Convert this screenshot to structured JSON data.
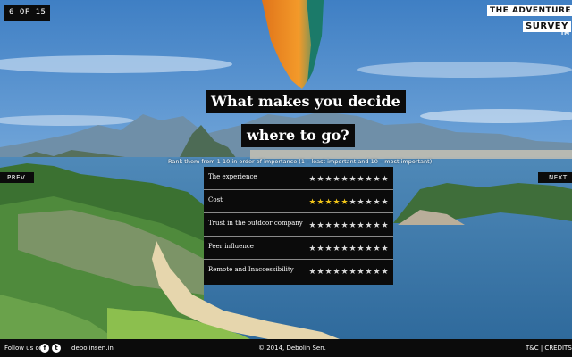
{
  "header": {
    "counter": "6 OF 15",
    "logo_line1": "THE ADVENTURE",
    "logo_line2": "SURVEY",
    "logo_tm": "TM"
  },
  "question": {
    "line1": "What makes you decide",
    "line2": "where to go?",
    "instructions": "Rank them from 1-10 in order of importance (1 – least important and 10 – most important)"
  },
  "nav": {
    "prev_label": "PREV",
    "next_label": "NEXT"
  },
  "ratings": [
    {
      "label": "The experience",
      "value": 0,
      "max": 10
    },
    {
      "label": "Cost",
      "value": 5,
      "max": 10
    },
    {
      "label": "Trust in the outdoor company",
      "value": 0,
      "max": 10
    },
    {
      "label": "Peer influence",
      "value": 0,
      "max": 10
    },
    {
      "label": "Remote and Inaccessibility",
      "value": 0,
      "max": 10
    }
  ],
  "footer": {
    "follow_label": "Follow us on:",
    "facebook_glyph": "f",
    "twitter_glyph": "t",
    "site": "debolinsen.in",
    "copyright": "© 2014, Debolin Sen.",
    "credits": "T&C | CREDITS"
  },
  "colors": {
    "sky": "#5a8fc7",
    "star_active": "#f0c419",
    "star_inactive": "#d8d8d8",
    "panel": "#0b0b0b"
  },
  "icons": {
    "prev": "prev-arrow",
    "next": "next-arrow",
    "facebook": "facebook-icon",
    "twitter": "twitter-icon",
    "star": "star-icon"
  }
}
